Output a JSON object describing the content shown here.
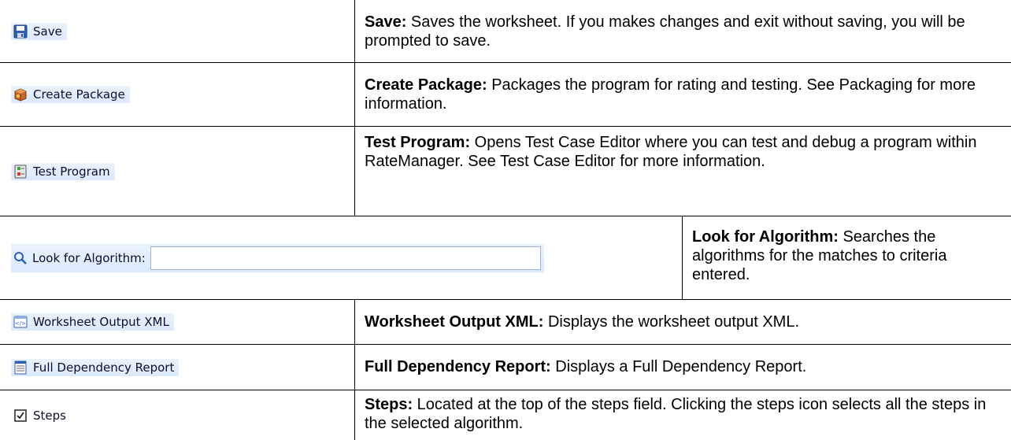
{
  "rows": [
    {
      "button_label": "Save",
      "icon": "save-icon",
      "term": "Save:",
      "desc": " Saves the worksheet. If you makes changes and exit without saving, you will be prompted to save."
    },
    {
      "button_label": "Create Package",
      "icon": "package-icon",
      "term": "Create Package:",
      "desc": " Packages the program for rating and testing. See Packaging for more information."
    },
    {
      "button_label": "Test Program",
      "icon": "test-program-icon",
      "term": "Test Program:",
      "desc": " Opens Test Case Editor where you can test and debug a program within RateManager. See Test Case Editor for more information."
    },
    {
      "button_label": "Look for Algorithm:",
      "icon": "search-icon",
      "input_value": "",
      "term": "Look for Algorithm:",
      "desc": " Searches the algorithms for the matches to criteria entered."
    },
    {
      "button_label": "Worksheet Output XML",
      "icon": "xml-output-icon",
      "term": "Worksheet Output XML:",
      "desc": " Displays the worksheet output XML."
    },
    {
      "button_label": "Full Dependency Report",
      "icon": "report-icon",
      "term": "Full Dependency Report:",
      "desc": " Displays a Full Dependency Report."
    },
    {
      "button_label": "Steps",
      "icon": "steps-checkbox-icon",
      "term": "Steps:",
      "desc": " Located at the top of the steps field. Clicking the steps icon selects all the steps in the selected algorithm."
    }
  ]
}
